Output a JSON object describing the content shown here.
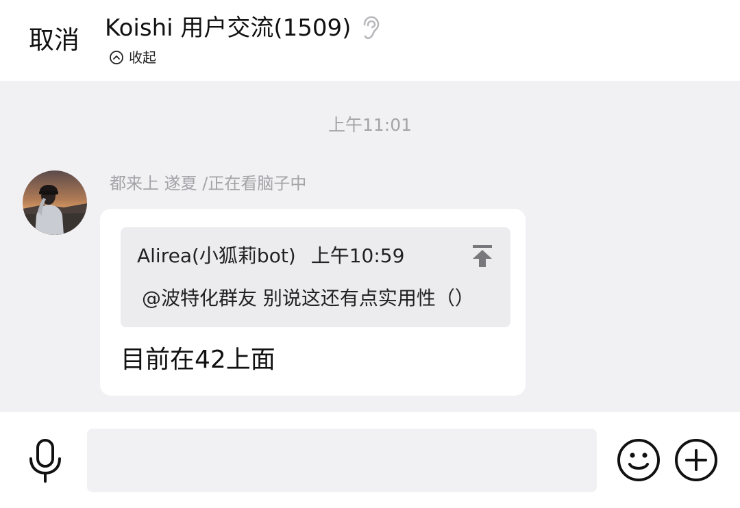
{
  "header": {
    "cancel_label": "取消",
    "group_title": "Koishi 用户交流(1509)",
    "ear_icon": "ear-icon",
    "collapse_label": "收起",
    "collapse_icon": "chevron-up-circle-icon"
  },
  "chat": {
    "timestamp": "上午11:01",
    "messages": [
      {
        "sender": "都来上 遂夏 /正在看脑子中",
        "avatar_icon": "user-avatar",
        "quote": {
          "author": "Alirea(小狐莉bot)",
          "time": "上午10:59",
          "text": "@波特化群友 别说这还有点实用性（）",
          "jump_icon": "jump-to-top-icon"
        },
        "text": "目前在42上面"
      }
    ]
  },
  "input_bar": {
    "mic_icon": "microphone-icon",
    "input_value": "",
    "input_placeholder": "",
    "emoji_icon": "emoji-icon",
    "plus_icon": "plus-circle-icon"
  },
  "colors": {
    "background": "#f1f0f3",
    "panel": "#ffffff",
    "quote_bg": "#ececef",
    "muted_text": "#a3a3a8",
    "primary_text": "#111111"
  }
}
